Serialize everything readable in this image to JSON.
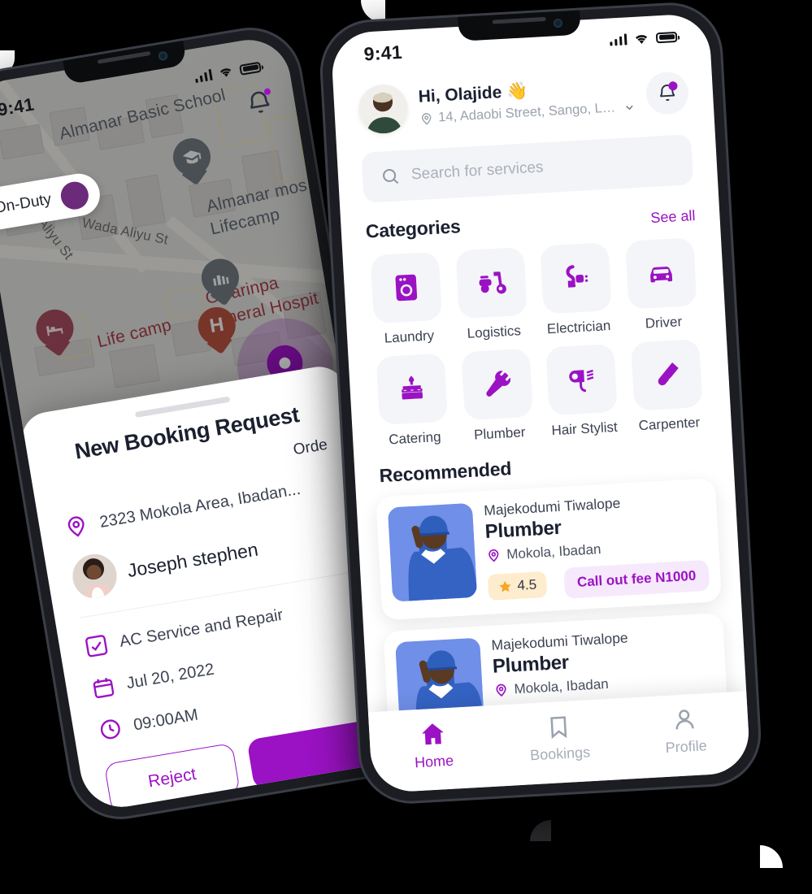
{
  "brand": {
    "purple": "#9b12c4",
    "dark": "#1b2030",
    "muted": "#9aa2ad",
    "star": "#f5a623"
  },
  "left_phone": {
    "status": {
      "time": "9:41"
    },
    "map": {
      "on_duty_label": "On-Duty",
      "labels": [
        {
          "text": "Almanar Basic School",
          "kind": "place"
        },
        {
          "text": "Almanar mos",
          "kind": "place"
        },
        {
          "text": "Lifecamp",
          "kind": "place"
        },
        {
          "text": "Life camp",
          "kind": "place-red"
        },
        {
          "text": "Gwarinpa",
          "kind": "place-red"
        },
        {
          "text": "General Hospit",
          "kind": "place-red"
        },
        {
          "text": "Wada Aliyu St",
          "kind": "street"
        },
        {
          "text": "ginda Aliyu St",
          "kind": "street"
        }
      ],
      "pins": [
        "school-pin",
        "mosque-pin",
        "hotel-pin",
        "hospital-pin",
        "hotel-pin-2",
        "user-location-pin"
      ]
    },
    "sheet": {
      "title": "New Booking Request",
      "order_label": "Orde",
      "address": "2323 Mokola Area, Ibadan...",
      "customer_name": "Joseph stephen",
      "service": "AC Service and Repair",
      "date": "Jul 20, 2022",
      "time": "09:00AM",
      "reject_label": "Reject",
      "accept_label": ""
    }
  },
  "right_phone": {
    "status": {
      "time": "9:41"
    },
    "header": {
      "greeting": "Hi, Olajide",
      "wave": "👋",
      "address": "14, Adaobi Street, Sango, Lag...",
      "avatar_name": "user-avatar"
    },
    "search": {
      "placeholder": "Search for services"
    },
    "categories_section": {
      "title": "Categories",
      "see_all": "See all"
    },
    "categories": [
      {
        "label": "Laundry",
        "icon": "washing-machine-icon"
      },
      {
        "label": "Logistics",
        "icon": "scooter-icon"
      },
      {
        "label": "Electrician",
        "icon": "plug-icon"
      },
      {
        "label": "Driver",
        "icon": "car-icon"
      },
      {
        "label": "Catering",
        "icon": "cake-icon"
      },
      {
        "label": "Plumber",
        "icon": "wrench-icon"
      },
      {
        "label": "Hair Stylist",
        "icon": "hairdryer-icon"
      },
      {
        "label": "Carpenter",
        "icon": "saw-icon"
      }
    ],
    "recommended_section": {
      "title": "Recommended"
    },
    "recommended": [
      {
        "name": "Majekodumi Tiwalope",
        "role": "Plumber",
        "location": "Mokola, Ibadan",
        "rating": "4.5",
        "fee": "Call out fee N1000"
      },
      {
        "name": "Majekodumi Tiwalope",
        "role": "Plumber",
        "location": "Mokola, Ibadan",
        "rating": "",
        "fee": ""
      }
    ],
    "tabs": [
      {
        "label": "Home",
        "icon": "home-icon",
        "active": true
      },
      {
        "label": "Bookings",
        "icon": "bookmark-icon",
        "active": false
      },
      {
        "label": "Profile",
        "icon": "person-icon",
        "active": false
      }
    ]
  }
}
